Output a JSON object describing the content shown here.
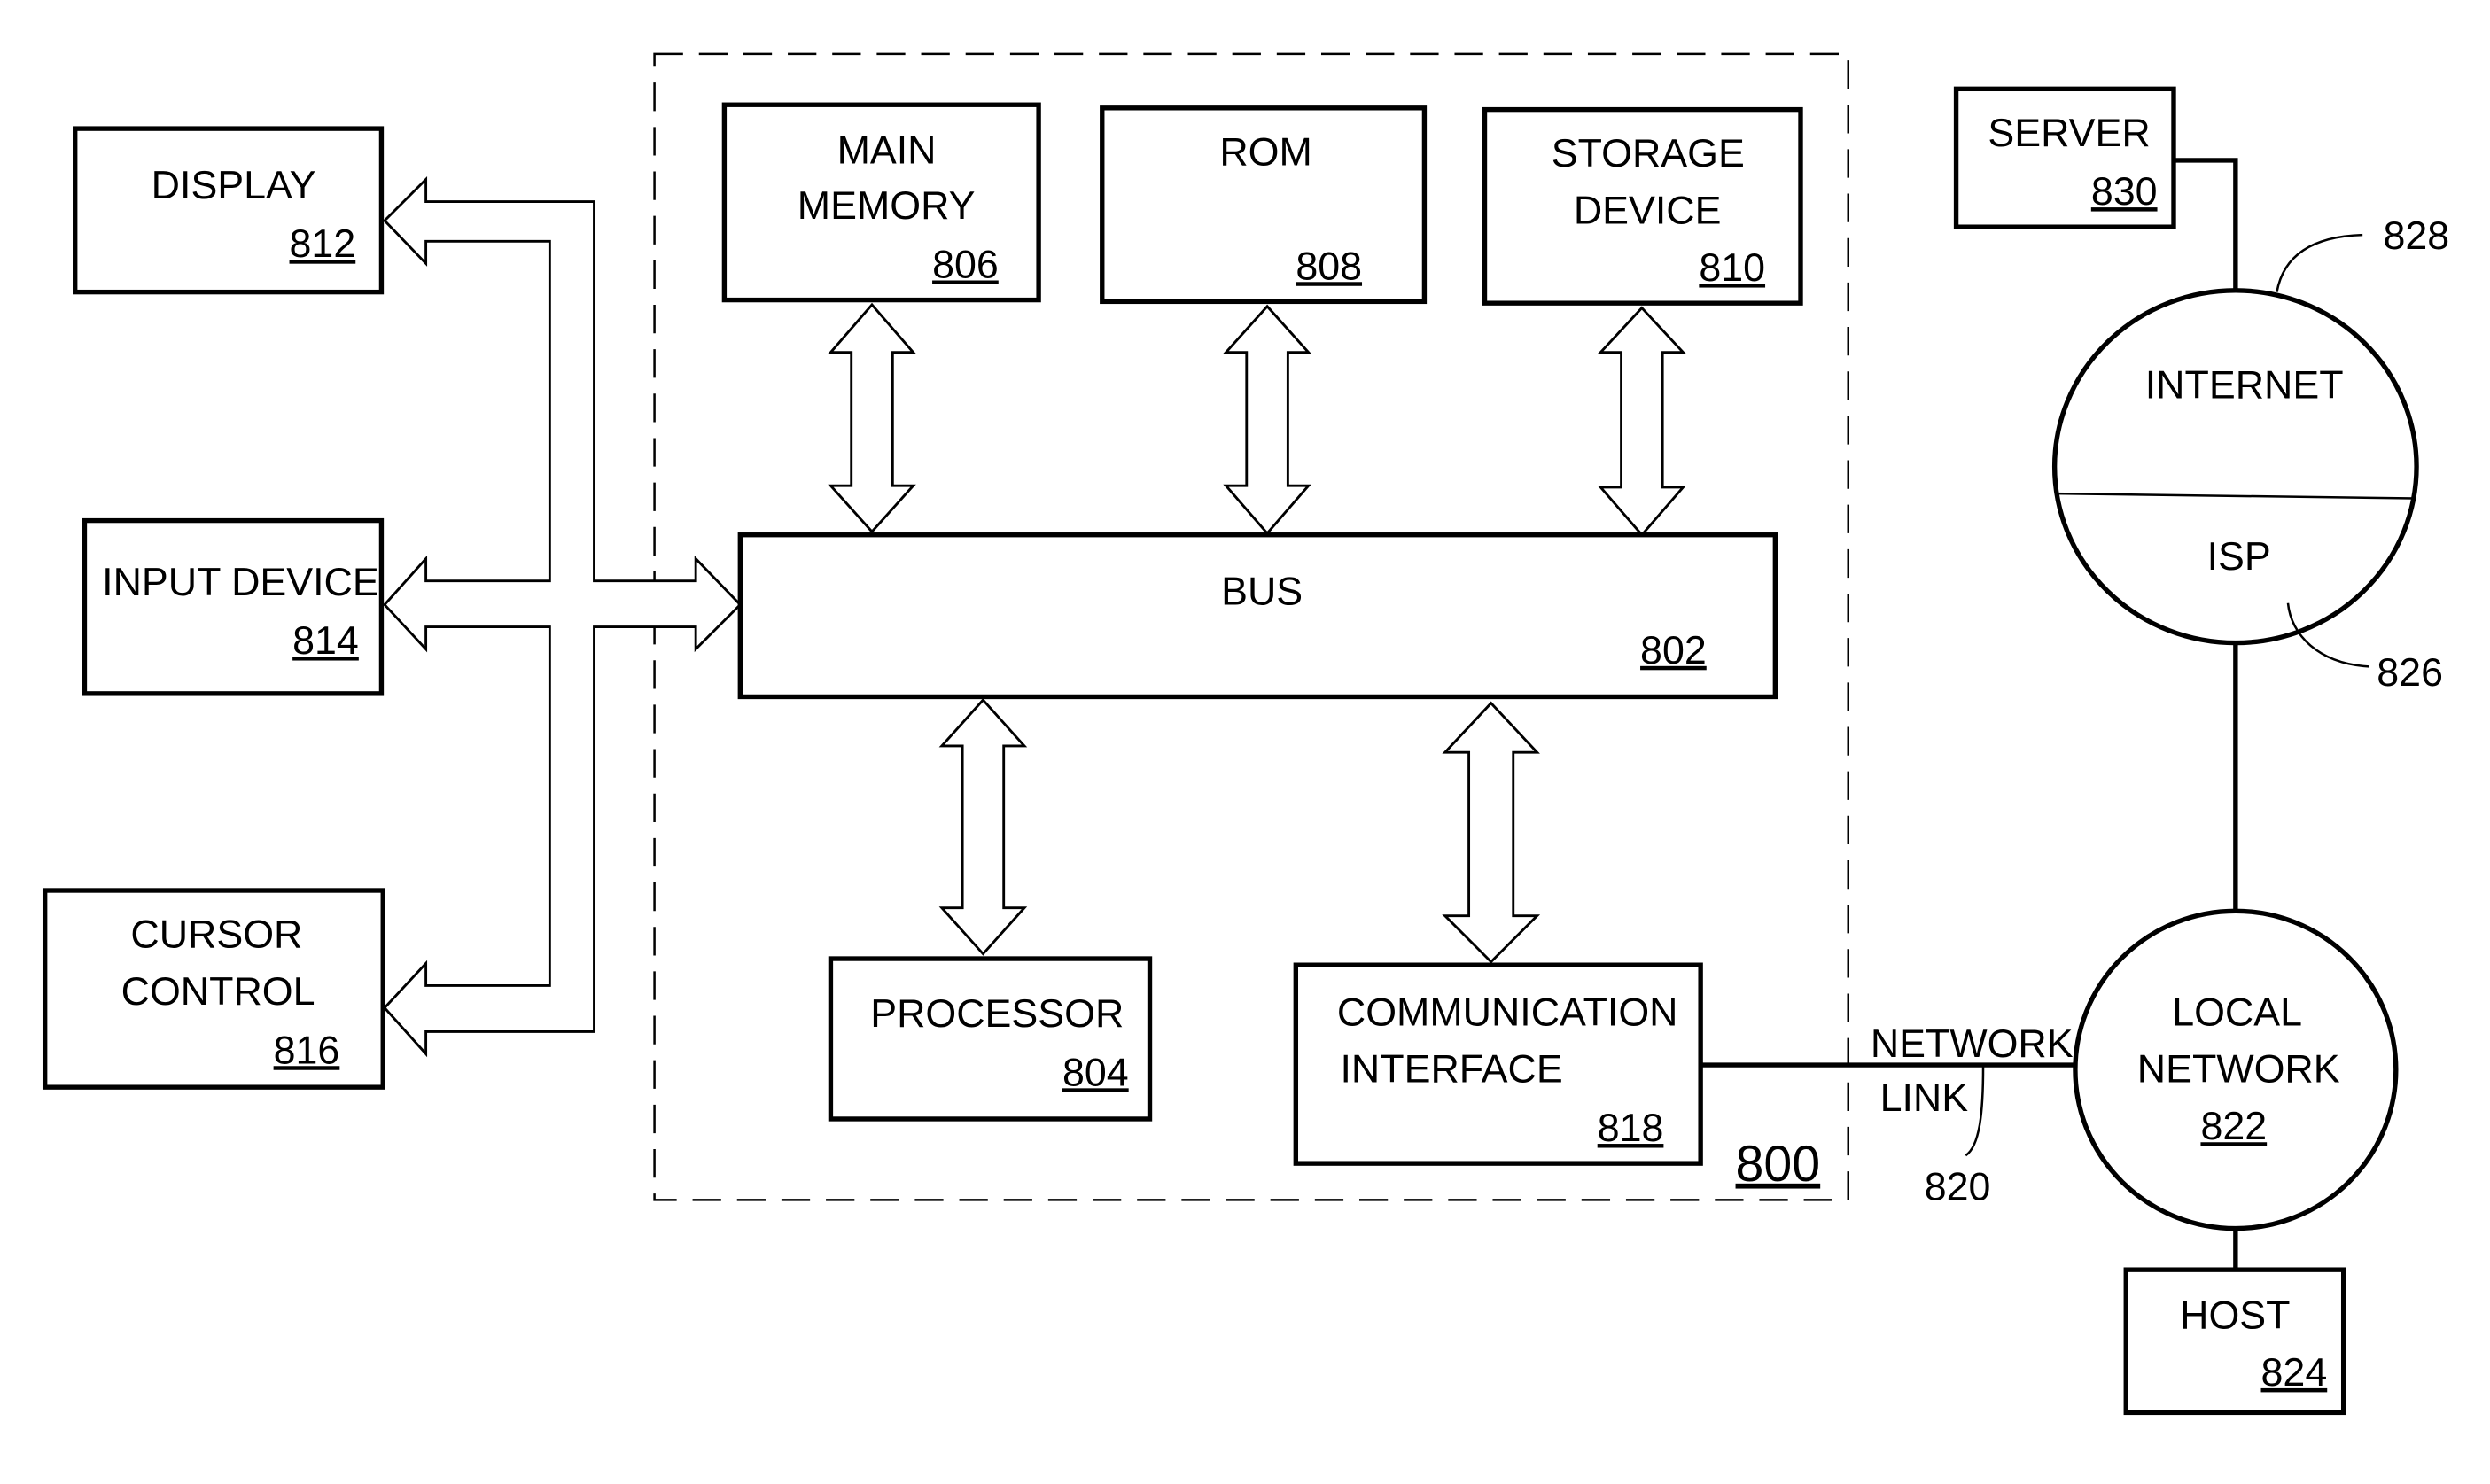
{
  "figure": {
    "system_ref": "800",
    "nodes": {
      "display": {
        "lines": [
          "DISPLAY"
        ],
        "ref": "812"
      },
      "input_device": {
        "lines": [
          "INPUT DEVICE"
        ],
        "ref": "814"
      },
      "cursor_control": {
        "lines": [
          "CURSOR",
          "CONTROL"
        ],
        "ref": "816"
      },
      "main_memory": {
        "lines": [
          "MAIN",
          "MEMORY"
        ],
        "ref": "806"
      },
      "rom": {
        "lines": [
          "ROM"
        ],
        "ref": "808"
      },
      "storage_device": {
        "lines": [
          "STORAGE",
          "DEVICE"
        ],
        "ref": "810"
      },
      "bus": {
        "lines": [
          "BUS"
        ],
        "ref": "802"
      },
      "processor": {
        "lines": [
          "PROCESSOR"
        ],
        "ref": "804"
      },
      "communication_interface": {
        "lines": [
          "COMMUNICATION",
          "INTERFACE"
        ],
        "ref": "818"
      },
      "network_link": {
        "lines": [
          "NETWORK",
          "LINK"
        ],
        "ref": "820"
      },
      "local_network": {
        "lines": [
          "LOCAL",
          "NETWORK"
        ],
        "ref": "822"
      },
      "host": {
        "lines": [
          "HOST"
        ],
        "ref": "824"
      },
      "isp": {
        "lines": [
          "ISP"
        ],
        "ref": "826"
      },
      "internet": {
        "lines": [
          "INTERNET"
        ],
        "ref": "828"
      },
      "server": {
        "lines": [
          "SERVER"
        ],
        "ref": "830"
      }
    },
    "edges": [
      {
        "from": "bus",
        "to": "display",
        "type": "bidirectional-arrow"
      },
      {
        "from": "bus",
        "to": "input_device",
        "type": "bidirectional-arrow"
      },
      {
        "from": "bus",
        "to": "cursor_control",
        "type": "bidirectional-arrow"
      },
      {
        "from": "main_memory",
        "to": "bus",
        "type": "bidirectional-arrow"
      },
      {
        "from": "rom",
        "to": "bus",
        "type": "bidirectional-arrow"
      },
      {
        "from": "storage_device",
        "to": "bus",
        "type": "bidirectional-arrow"
      },
      {
        "from": "bus",
        "to": "processor",
        "type": "bidirectional-arrow"
      },
      {
        "from": "bus",
        "to": "communication_interface",
        "type": "bidirectional-arrow"
      },
      {
        "from": "communication_interface",
        "to": "local_network",
        "type": "line",
        "label": "network_link"
      },
      {
        "from": "local_network",
        "to": "host",
        "type": "line"
      },
      {
        "from": "local_network",
        "to": "isp",
        "type": "line"
      },
      {
        "from": "internet",
        "to": "server",
        "type": "line"
      }
    ]
  }
}
